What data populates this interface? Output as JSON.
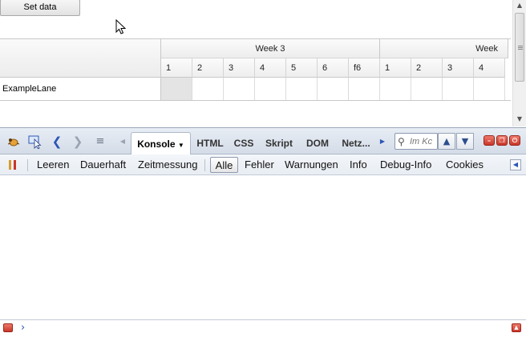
{
  "page": {
    "set_data_label": "Set data"
  },
  "timeline": {
    "weeks": [
      {
        "label": "Week 3"
      },
      {
        "label": "Week"
      }
    ],
    "days": [
      "1",
      "2",
      "3",
      "4",
      "5",
      "6",
      "f6",
      "1",
      "2",
      "3",
      "4"
    ],
    "lanes": [
      {
        "label": "ExampleLane"
      }
    ]
  },
  "firebug": {
    "tabs": [
      {
        "label": "Konsole",
        "active": true
      },
      {
        "label": "HTML"
      },
      {
        "label": "CSS"
      },
      {
        "label": "Skript"
      },
      {
        "label": "DOM"
      },
      {
        "label": "Netz..."
      }
    ],
    "search_placeholder": "Im Kc",
    "console_toolbar": {
      "leeren": "Leeren",
      "dauerhaft": "Dauerhaft",
      "zeitmessung": "Zeitmessung",
      "alle": "Alle",
      "fehler": "Fehler",
      "warnungen": "Warnungen",
      "info": "Info",
      "debug_info": "Debug-Info",
      "cookies": "Cookies"
    },
    "icons": {
      "firebug": "firebug-bug-icon",
      "inspect": "inspect-element-icon",
      "back": "chevron-left-icon",
      "forward": "chevron-right-icon",
      "script_list": "script-list-icon",
      "search": "search-icon",
      "prev": "chevron-up-icon",
      "next": "chevron-down-icon",
      "minimize": "minimize-icon",
      "detach": "detach-window-icon",
      "close": "power-close-icon",
      "break_on_error": "break-on-error-icon",
      "collapse": "triangle-left-icon",
      "cmd_error": "error-icon",
      "cmd_prompt": "prompt-chevron-icon",
      "cmd_expand": "expand-up-icon"
    },
    "accent": "#2b56b6",
    "close_color": "#c9362a"
  }
}
